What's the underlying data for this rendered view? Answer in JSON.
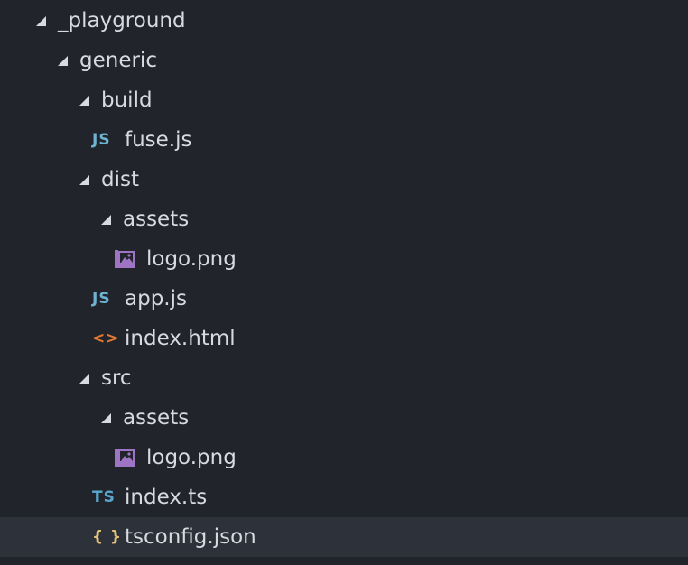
{
  "colors": {
    "background": "#21252b",
    "selected_row": "#2c313a",
    "text": "#d7dae0",
    "js_icon": "#6fb3d2",
    "ts_icon": "#5aa6cf",
    "html_icon": "#e37933",
    "image_icon": "#a074c4",
    "json_icon": "#e5c07b"
  },
  "tree": {
    "items": [
      {
        "label": "_playground",
        "type": "folder",
        "expanded": true
      },
      {
        "label": "generic",
        "type": "folder",
        "expanded": true
      },
      {
        "label": "build",
        "type": "folder",
        "expanded": true
      },
      {
        "label": "fuse.js",
        "type": "file",
        "icon": "js-file-icon",
        "icon_text": "JS"
      },
      {
        "label": "dist",
        "type": "folder",
        "expanded": true
      },
      {
        "label": "assets",
        "type": "folder",
        "expanded": true
      },
      {
        "label": "logo.png",
        "type": "file",
        "icon": "image-file-icon"
      },
      {
        "label": "app.js",
        "type": "file",
        "icon": "js-file-icon",
        "icon_text": "JS"
      },
      {
        "label": "index.html",
        "type": "file",
        "icon": "html-file-icon",
        "icon_text": "<>"
      },
      {
        "label": "src",
        "type": "folder",
        "expanded": true
      },
      {
        "label": "assets",
        "type": "folder",
        "expanded": true
      },
      {
        "label": "logo.png",
        "type": "file",
        "icon": "image-file-icon"
      },
      {
        "label": "index.ts",
        "type": "file",
        "icon": "ts-file-icon",
        "icon_text": "TS"
      },
      {
        "label": "tsconfig.json",
        "type": "file",
        "icon": "json-file-icon",
        "icon_text": "{ }",
        "selected": true
      }
    ]
  }
}
